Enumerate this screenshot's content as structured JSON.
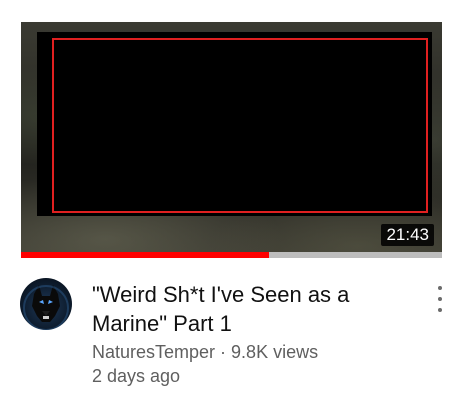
{
  "video": {
    "duration": "21:43",
    "watch_progress_percent": 59,
    "title_line1": "\"Weird Sh*t I've Seen as a",
    "title_line2": "Marine\" Part 1",
    "channel": "NaturesTemper",
    "separator": " · ",
    "views": "9.8K views",
    "age": "2 days ago"
  },
  "colors": {
    "progress": "#ff0000",
    "redaction_border": "#e02020"
  },
  "icons": {
    "menu": "more-vert-icon",
    "avatar": "wolf-avatar"
  }
}
